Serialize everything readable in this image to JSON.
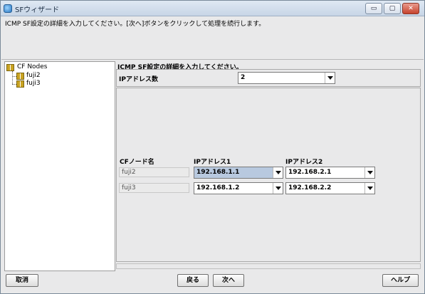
{
  "window": {
    "title": "SFウィザード",
    "minimize_glyph": "▭",
    "maximize_glyph": "▢",
    "close_glyph": "✕"
  },
  "instruction": "ICMP SF設定の詳細を入力してください。[次へ]ボタンをクリックして処理を続行します。",
  "tree": {
    "root": "CF Nodes",
    "children": [
      "fuji2",
      "fuji3"
    ]
  },
  "panel": {
    "title": "ICMP SF設定の詳細を入力してください。",
    "ip_count_label": "IPアドレス数",
    "ip_count_value": "2",
    "table": {
      "headers": [
        "CFノード名",
        "IPアドレス1",
        "IPアドレス2"
      ],
      "rows": [
        {
          "node": "fuji2",
          "ip1": "192.168.1.1",
          "ip2": "192.168.2.1"
        },
        {
          "node": "fuji3",
          "ip1": "192.168.1.2",
          "ip2": "192.168.2.2"
        }
      ]
    }
  },
  "buttons": {
    "cancel": "取消",
    "back": "戻る",
    "next": "次へ",
    "help": "ヘルプ"
  },
  "colors": {
    "selected_combo": "#b8c9df",
    "window_bg": "#e9e9ea",
    "titlebar": "#c7d5e6"
  }
}
